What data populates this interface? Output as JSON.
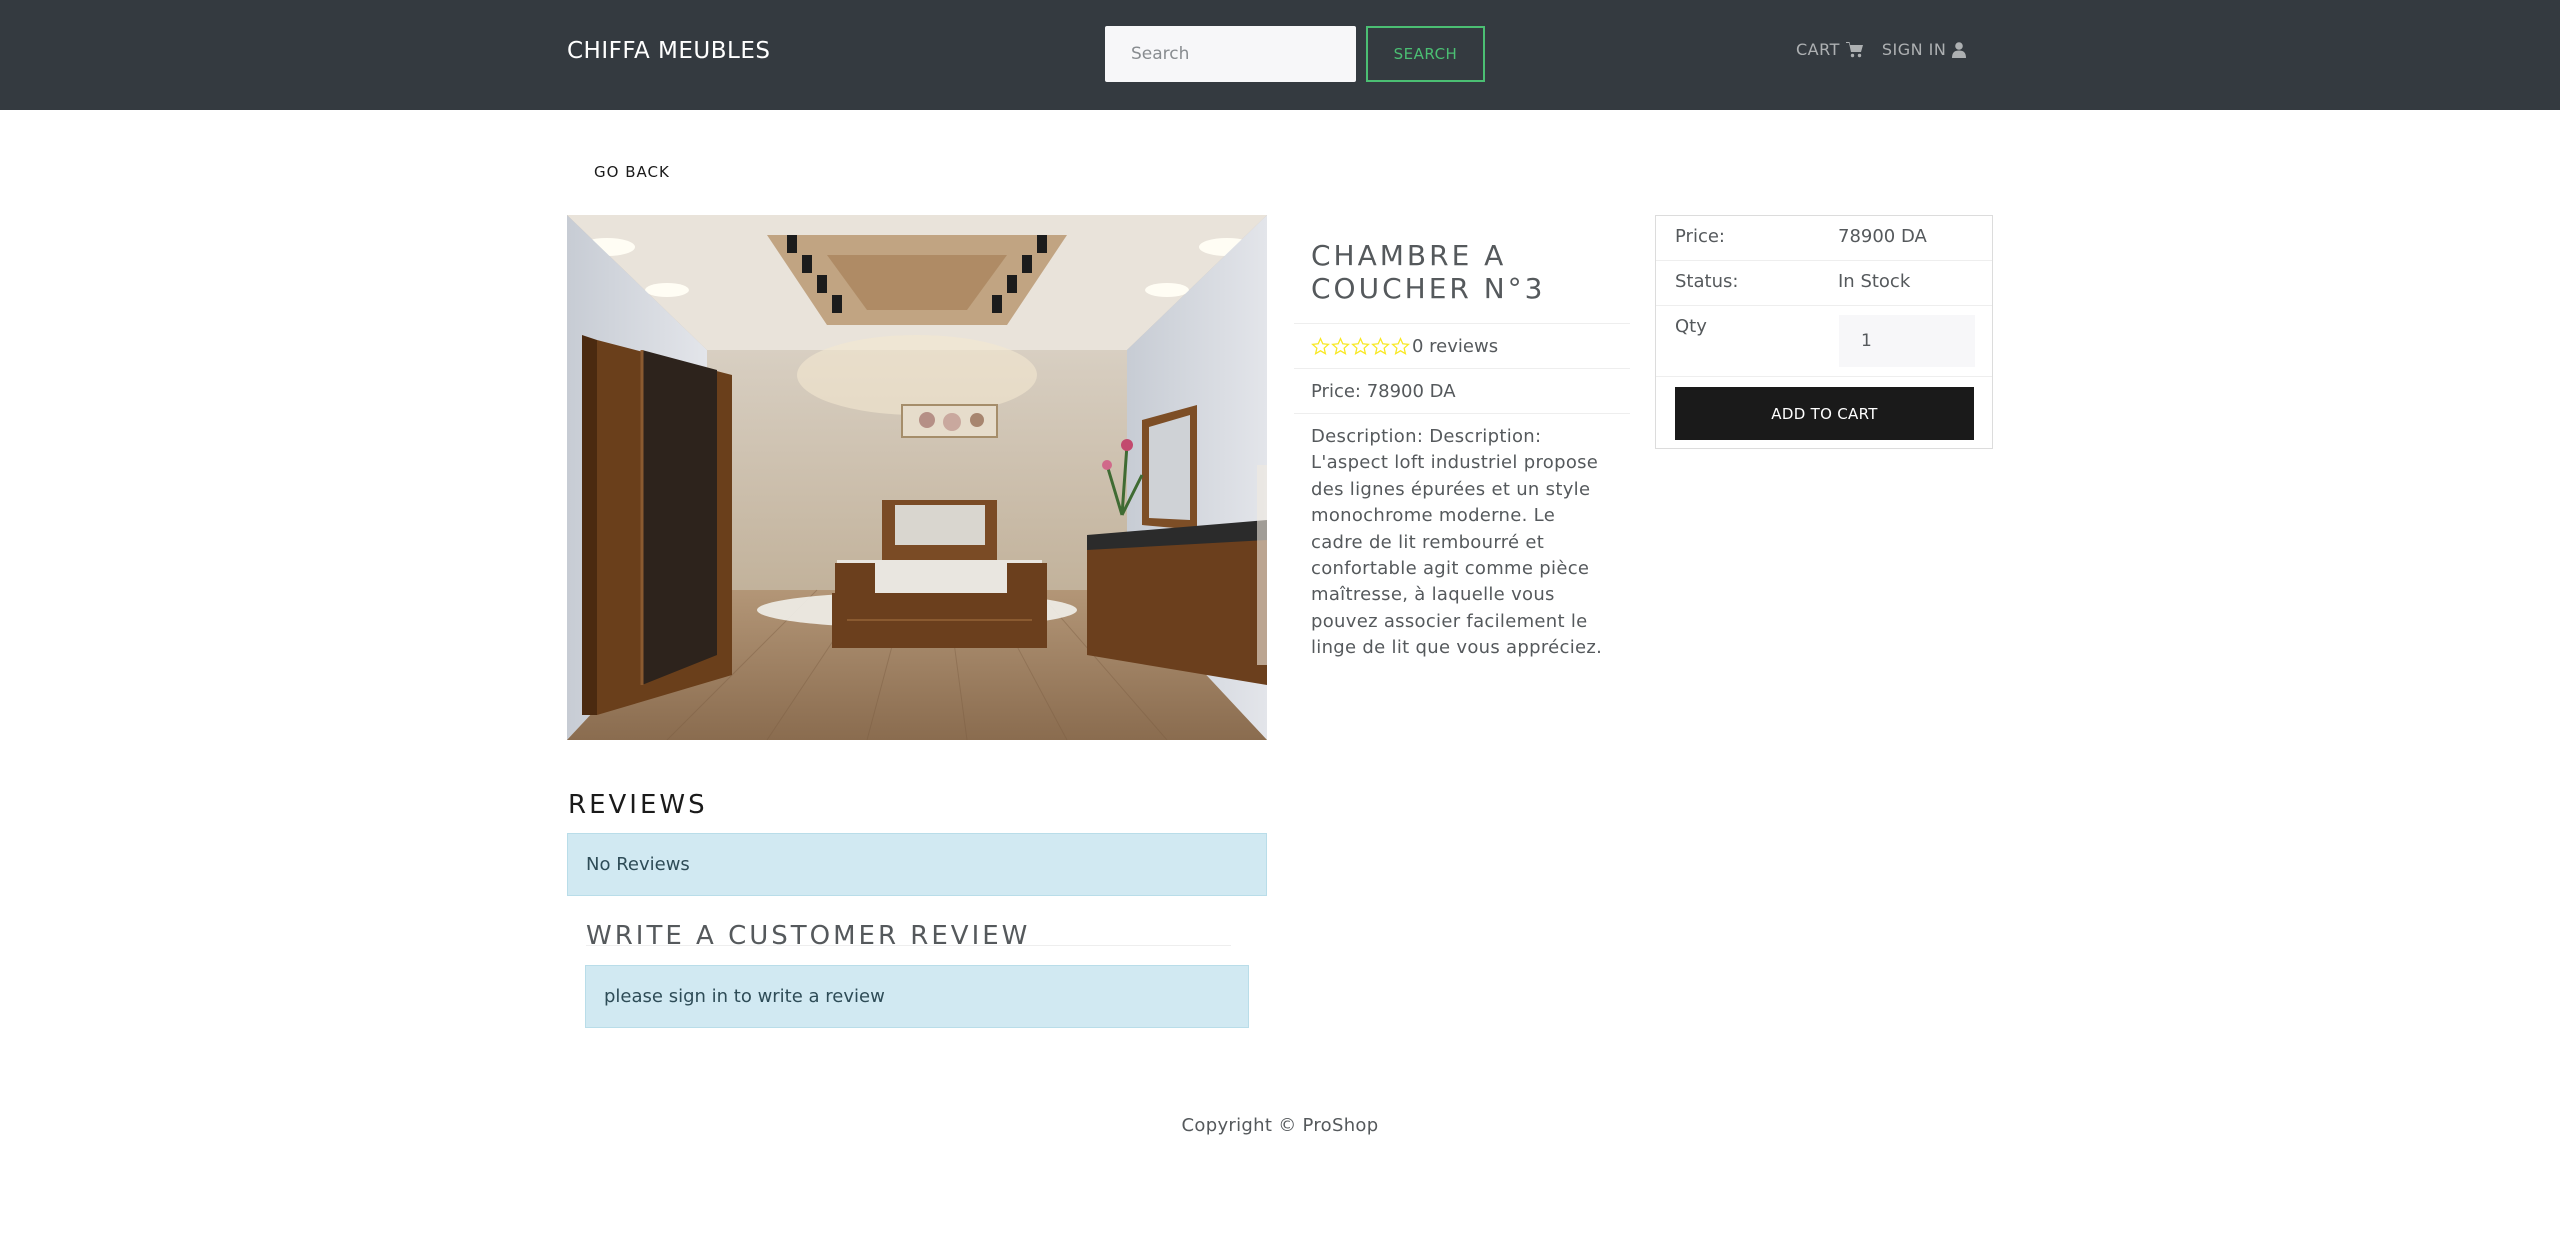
{
  "header": {
    "brand": "CHIFFA MEUBLES",
    "search_placeholder": "Search",
    "search_button": "SEARCH",
    "cart_label": "CART",
    "cart_icon": "shopping-cart-icon",
    "signin_label": "SIGN IN",
    "signin_icon": "user-icon",
    "background_color": "#343a40",
    "accent_color": "#4bbf73"
  },
  "go_back_label": "GO BACK",
  "product": {
    "name": "CHAMBRE A COUCHER N°3",
    "rating": 0,
    "reviews_text": "0 reviews",
    "price_text": "Price: 78900 DA",
    "description": "Description: Description: L'aspect loft industriel propose des lignes épurées et un style monochrome moderne. Le cadre de lit rembourré et confortable agit comme pièce maîtresse, à laquelle vous pouvez associer facilement le linge de lit que vous appréciez.",
    "star_color": "#f8e825"
  },
  "purchase_card": {
    "price_label": "Price:",
    "price_value": "78900 DA",
    "status_label": "Status:",
    "status_value": "In Stock",
    "qty_label": "Qty",
    "qty_value": "1",
    "add_to_cart": "ADD TO CART"
  },
  "reviews": {
    "heading": "REVIEWS",
    "empty_message": "No Reviews",
    "write_heading": "WRITE A CUSTOMER REVIEW",
    "signin_message": "please sign in to write a review"
  },
  "footer": {
    "copyright": "Copyright © ProShop"
  }
}
